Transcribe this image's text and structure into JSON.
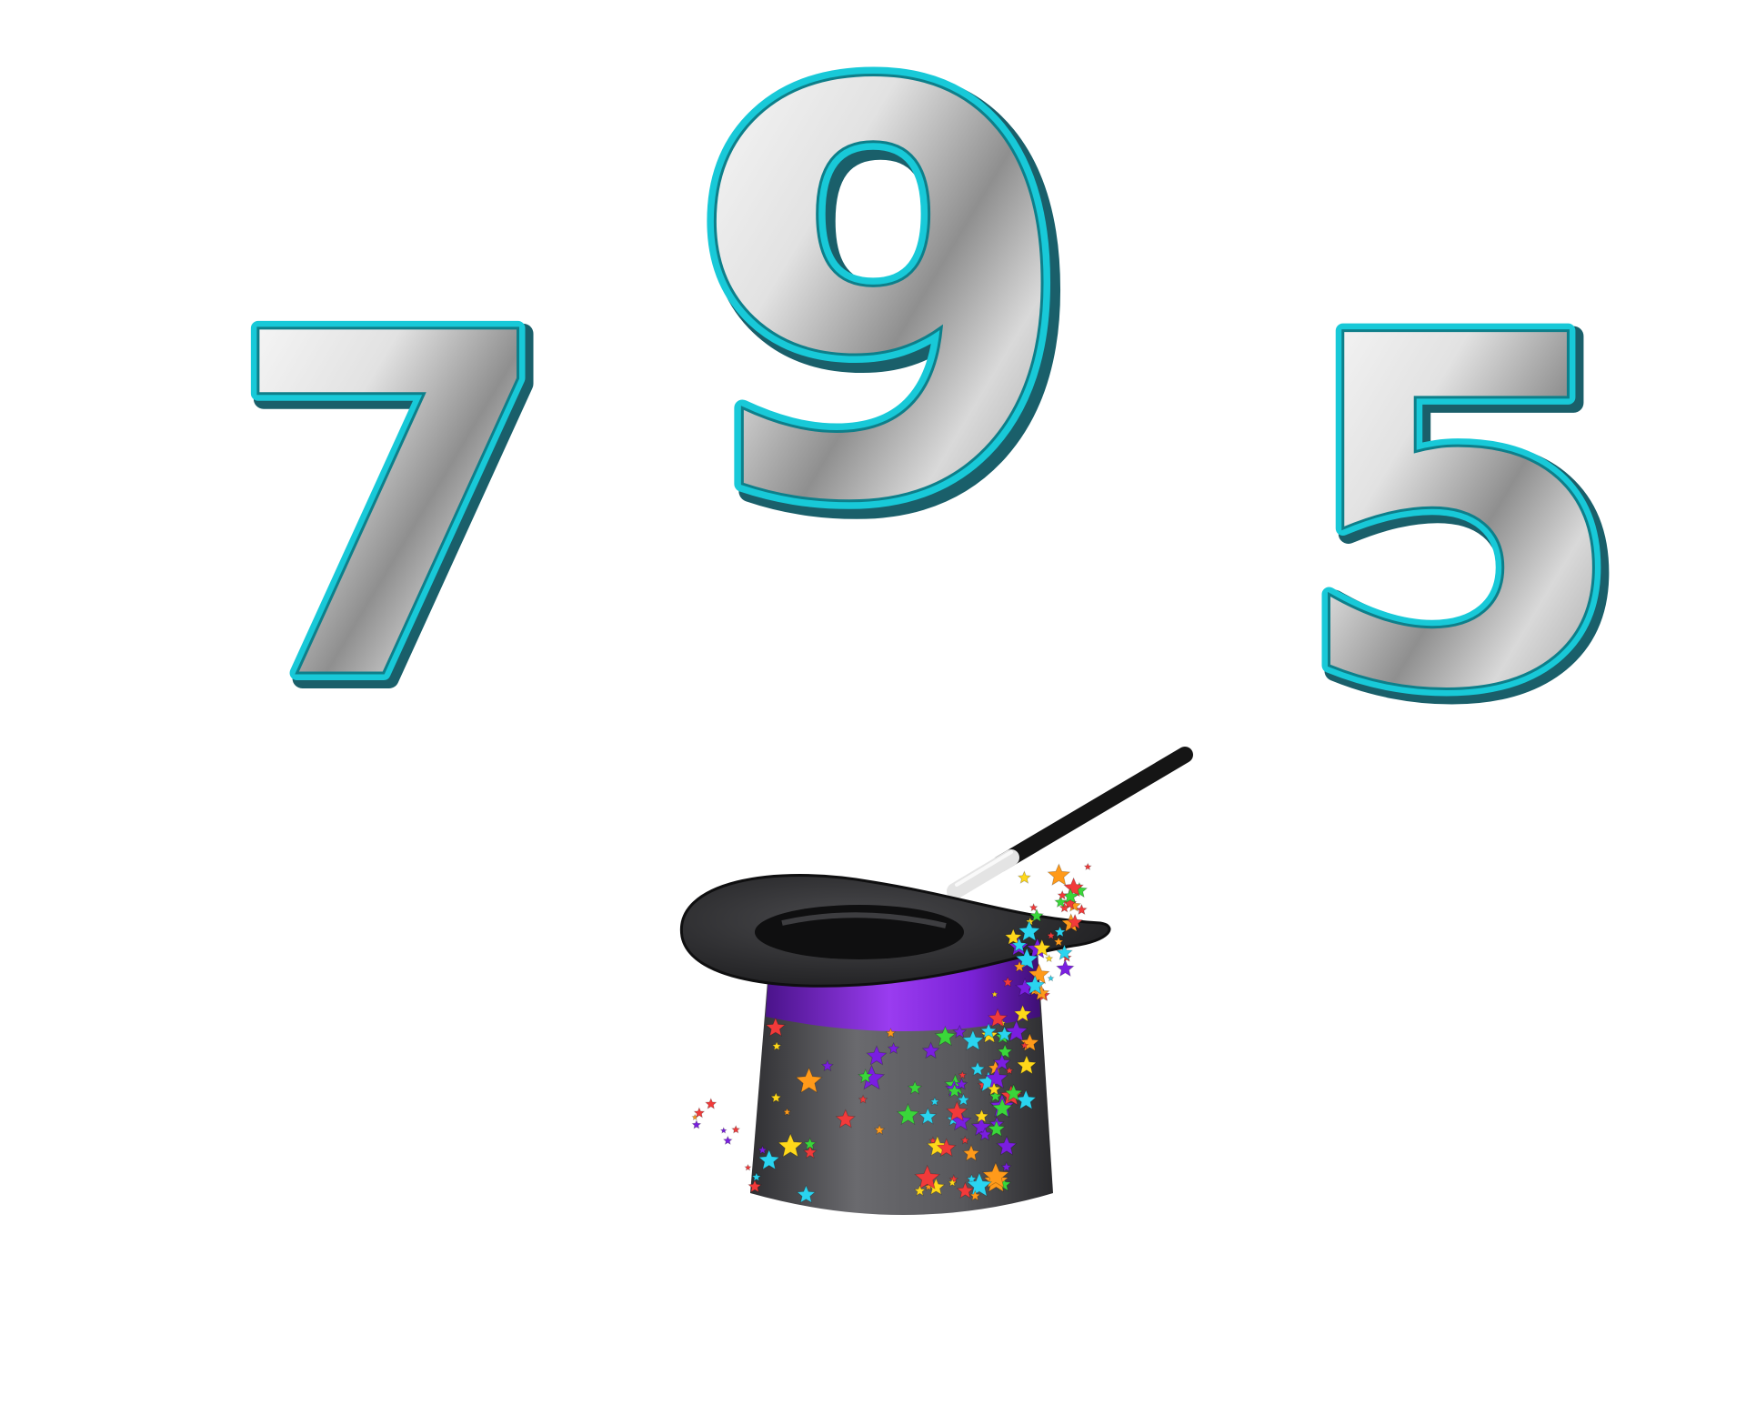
{
  "digits": [
    "7",
    "9",
    "5"
  ],
  "colors": {
    "background": "#ffffff",
    "digit_outline": "#18c9d8",
    "digit_outline_dark": "#1a5f6a",
    "digit_face_light": "#ffffff",
    "digit_face_mid": "#b9b9b9",
    "digit_face_dark": "#7c7c7c",
    "hat_body": "#5a5a5e",
    "hat_brim": "#2a2a2c",
    "hat_band": "#8b2be2",
    "wand_shaft": "#151515",
    "wand_tip": "#e8e8e8"
  },
  "star_palette": [
    "#ffd81a",
    "#f23a3a",
    "#3ad63a",
    "#7a1ee0",
    "#2ad4f0",
    "#ff9a1a"
  ],
  "icons": [
    "magic-hat-icon",
    "magic-wand-icon",
    "star-icon"
  ]
}
